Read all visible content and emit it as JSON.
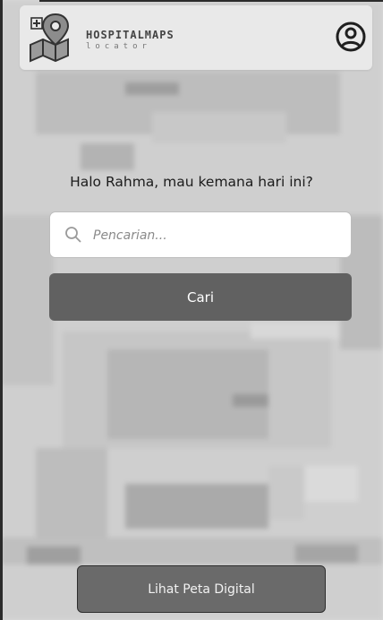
{
  "app": {
    "brand_name": "HOSPITALMAPS",
    "brand_sub": "locator"
  },
  "icons": {
    "logo": "map-pin-logo-icon",
    "profile": "user-circle-icon",
    "search": "search-icon"
  },
  "main": {
    "greeting": "Halo Rahma, mau kemana hari ini?",
    "search_placeholder": "Pencarian...",
    "search_value": "",
    "search_button": "Cari"
  },
  "footer": {
    "map_button": "Lihat Peta Digital"
  },
  "colors": {
    "button_dark": "#616161",
    "header_bg": "#e9e9e9",
    "map_bg": "#cfcfcf"
  }
}
